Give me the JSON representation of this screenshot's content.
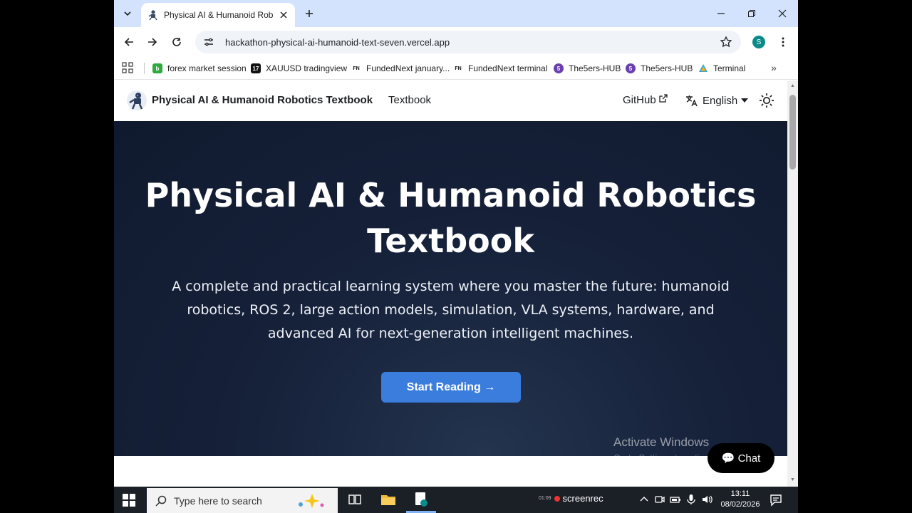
{
  "browser": {
    "tab_title": "Physical AI & Humanoid Roboti",
    "url": "hackathon-physical-ai-humanoid-text-seven.vercel.app",
    "profile_initial": "S",
    "bookmarks": [
      {
        "label": "forex market session",
        "color": "#2eaa3f",
        "glyph": "b"
      },
      {
        "label": "XAUUSD tradingview",
        "color": "#111111",
        "glyph": "17"
      },
      {
        "label": "FundedNext january...",
        "color": "#ffffff",
        "glyph": "FN"
      },
      {
        "label": "FundedNext terminal",
        "color": "#ffffff",
        "glyph": "FN"
      },
      {
        "label": "The5ers-HUB",
        "color": "#6a3fb0",
        "glyph": "5"
      },
      {
        "label": "The5ers-HUB",
        "color": "#6a3fb0",
        "glyph": "5"
      },
      {
        "label": "Terminal",
        "color": "#3aa0d8",
        "glyph": ""
      }
    ]
  },
  "site": {
    "title": "Physical AI & Humanoid Robotics Textbook",
    "nav_textbook": "Textbook",
    "nav_github": "GitHub",
    "nav_language": "English",
    "hero_title": "Physical AI & Humanoid Robotics Textbook",
    "hero_subtitle": "A complete and practical learning system where you master the future: humanoid robotics, ROS 2, large action models, simulation, VLA systems, hardware, and advanced AI for next-generation intelligent machines.",
    "cta_label": "Start Reading →",
    "chat_label": "💬 Chat"
  },
  "overlay": {
    "activate_title": "Activate Windows",
    "activate_sub": "Go to Settings to activate Windows."
  },
  "taskbar": {
    "search_placeholder": "Type here to search",
    "recorder_label": "screenrec",
    "recorder_time": "01:09",
    "clock_time": "13:11",
    "clock_date": "08/02/2026"
  }
}
